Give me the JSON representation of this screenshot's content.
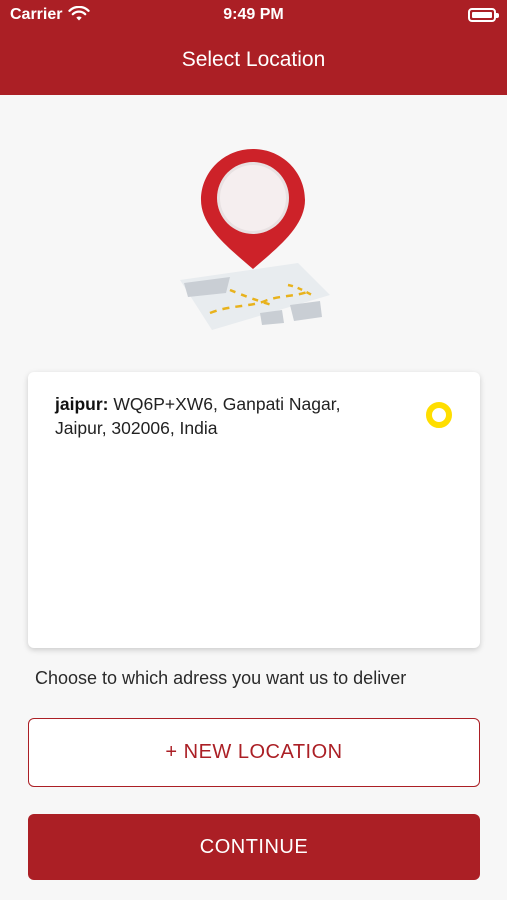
{
  "status_bar": {
    "carrier": "Carrier",
    "time": "9:49 PM",
    "wifi_icon": "wifi-icon",
    "battery_icon": "battery-icon"
  },
  "header": {
    "title": "Select Location"
  },
  "illustration": {
    "icon": "map-pin-icon"
  },
  "location_card": {
    "city": "jaipur:",
    "address": "WQ6P+XW6, Ganpati Nagar, Jaipur, 302006, India",
    "selected": true
  },
  "hint_text": "Choose to which adress you want us to deliver",
  "buttons": {
    "new_location": "+ NEW LOCATION",
    "continue": "CONTINUE"
  },
  "colors": {
    "primary": "#ab1f25",
    "radio": "#ffde00",
    "background": "#f7f7f7"
  }
}
